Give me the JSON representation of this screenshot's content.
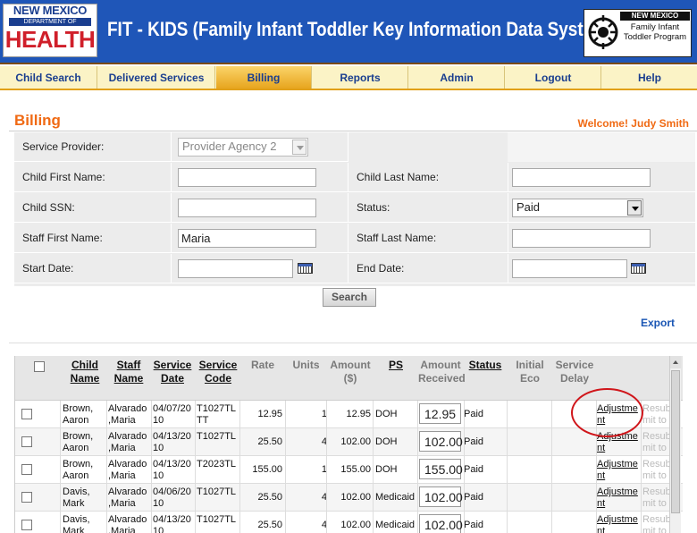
{
  "header": {
    "logo_left": {
      "line1": "NEW MEXICO",
      "line2": "DEPARTMENT OF",
      "line3": "HEALTH"
    },
    "title": "FIT - KIDS (Family Infant Toddler Key Information Data System)",
    "logo_right": {
      "state": "NEW MEXICO",
      "program": "Family Infant Toddler Program"
    }
  },
  "nav": {
    "tabs": [
      {
        "label": "Child Search"
      },
      {
        "label": "Delivered Services"
      },
      {
        "label": "Billing"
      },
      {
        "label": "Reports"
      },
      {
        "label": "Admin"
      },
      {
        "label": "Logout"
      },
      {
        "label": "Help"
      }
    ],
    "active_tab": "Billing"
  },
  "page": {
    "title": "Billing",
    "welcome": "Welcome! Judy Smith"
  },
  "filters": {
    "service_provider": {
      "label": "Service Provider:",
      "value": "Provider Agency 2"
    },
    "child_first_name": {
      "label": "Child First Name:",
      "value": ""
    },
    "child_last_name": {
      "label": "Child Last Name:",
      "value": ""
    },
    "child_ssn": {
      "label": "Child SSN:",
      "value": ""
    },
    "status": {
      "label": "Status:",
      "value": "Paid"
    },
    "staff_first_name": {
      "label": "Staff First Name:",
      "value": "Maria"
    },
    "staff_last_name": {
      "label": "Staff Last Name:",
      "value": ""
    },
    "start_date": {
      "label": "Start Date:",
      "value": ""
    },
    "end_date": {
      "label": "End Date:",
      "value": ""
    }
  },
  "actions": {
    "search_label": "Search",
    "export_label": "Export"
  },
  "table": {
    "headers": {
      "child_name": "Child Name",
      "staff_name": "Staff Name",
      "service_date": "Service Date",
      "service_code": "Service Code",
      "rate": "Rate",
      "units": "Units",
      "amount": "Amount ($)",
      "ps": "PS",
      "amount_received": "Amount Received",
      "status": "Status",
      "initial_eco": "Initial Eco",
      "service_delay": "Service Delay"
    },
    "rows": [
      {
        "child": "Brown, Aaron",
        "staff": "Alvarado ,Maria",
        "date": "04/07/2010",
        "code": "T1027TL TT",
        "rate": "12.95",
        "units": "1",
        "amount": "12.95",
        "ps": "DOH",
        "received": "12.95",
        "status": "Paid",
        "adjust": "Adjustment",
        "resubmit": "Resubmit to DOH"
      },
      {
        "child": "Brown, Aaron",
        "staff": "Alvarado ,Maria",
        "date": "04/13/2010",
        "code": "T1027TL",
        "rate": "25.50",
        "units": "4",
        "amount": "102.00",
        "ps": "DOH",
        "received": "102.00",
        "status": "Paid",
        "adjust": "Adjustment",
        "resubmit": "Resubmit to DOH"
      },
      {
        "child": "Brown, Aaron",
        "staff": "Alvarado ,Maria",
        "date": "04/13/2010",
        "code": "T2023TL",
        "rate": "155.00",
        "units": "1",
        "amount": "155.00",
        "ps": "DOH",
        "received": "155.00",
        "status": "Paid",
        "adjust": "Adjustment",
        "resubmit": "Resubmit to DOH"
      },
      {
        "child": "Davis, Mark",
        "staff": "Alvarado ,Maria",
        "date": "04/06/2010",
        "code": "T1027TL",
        "rate": "25.50",
        "units": "4",
        "amount": "102.00",
        "ps": "Medicaid",
        "received": "102.00",
        "status": "Paid",
        "adjust": "Adjustment",
        "resubmit": "Resubmit to DOH"
      },
      {
        "child": "Davis, Mark",
        "staff": "Alvarado ,Maria",
        "date": "04/13/2010",
        "code": "T1027TL",
        "rate": "25.50",
        "units": "4",
        "amount": "102.00",
        "ps": "Medicaid",
        "received": "102.00",
        "status": "Paid",
        "adjust": "Adjustment",
        "resubmit": "Resubmit to DOH"
      }
    ]
  },
  "colors": {
    "header_blue": "#1f56b8",
    "accent_orange": "#f06a14",
    "annotation_red": "#d01f2a"
  }
}
